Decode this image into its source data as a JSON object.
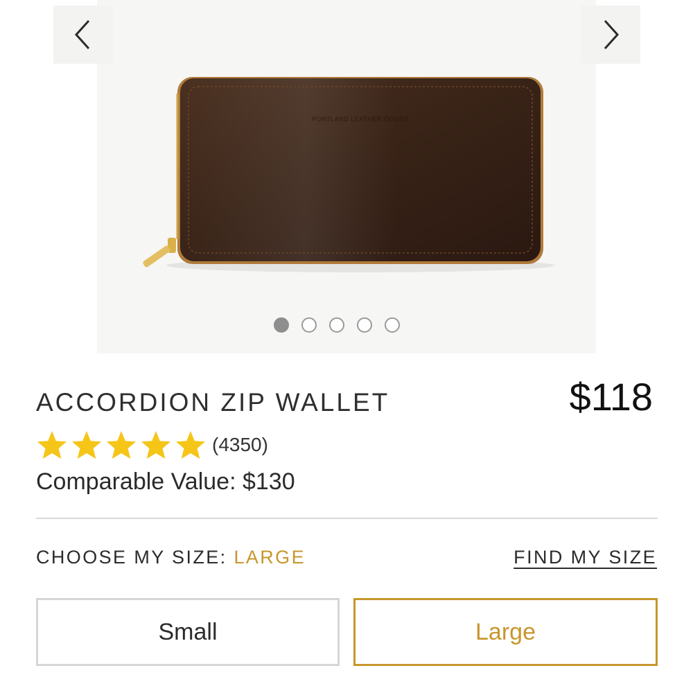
{
  "gallery": {
    "slide_count": 5,
    "active_slide": 1,
    "wallet_stamp": "PORTLAND LEATHER GOODS"
  },
  "product": {
    "title": "ACCORDION ZIP WALLET",
    "price": "$118",
    "rating": 5,
    "review_count": "(4350)",
    "comparable_value": "Comparable Value: $130"
  },
  "size": {
    "label": "CHOOSE MY SIZE:",
    "selected": "LARGE",
    "find_size_link": "FIND MY SIZE",
    "options": [
      {
        "label": "Small",
        "selected": false
      },
      {
        "label": "Large",
        "selected": true
      }
    ]
  },
  "colors": {
    "accent": "#c8962c",
    "star": "#f5c518",
    "leather": "#3a2418"
  }
}
